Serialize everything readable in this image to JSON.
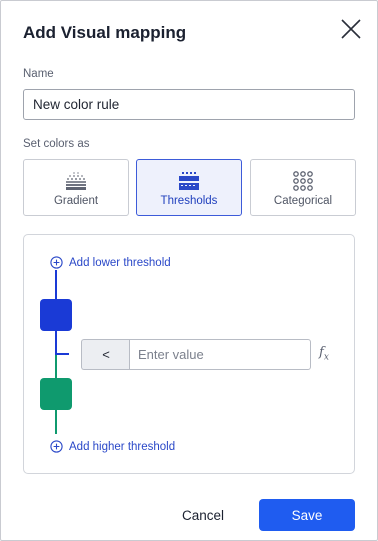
{
  "dialog": {
    "title": "Add Visual mapping",
    "close_icon": "close-icon"
  },
  "name_field": {
    "label": "Name",
    "value": "New color rule"
  },
  "color_mode": {
    "label": "Set colors as",
    "options": [
      {
        "label": "Gradient",
        "icon": "gradient-icon",
        "selected": false
      },
      {
        "label": "Thresholds",
        "icon": "thresholds-icon",
        "selected": true
      },
      {
        "label": "Categorical",
        "icon": "categorical-icon",
        "selected": false
      }
    ]
  },
  "thresholds": {
    "add_lower_label": "Add lower threshold",
    "add_higher_label": "Add higher threshold",
    "operator": "<",
    "value": "",
    "value_placeholder": "Enter value",
    "formula_icon": "function-icon",
    "lower_color": "#1a3ad6",
    "upper_color": "#0f9a6e"
  },
  "colors": {
    "accent": "#1f5cf0",
    "link": "#2a48c8"
  },
  "footer": {
    "cancel_label": "Cancel",
    "save_label": "Save"
  }
}
